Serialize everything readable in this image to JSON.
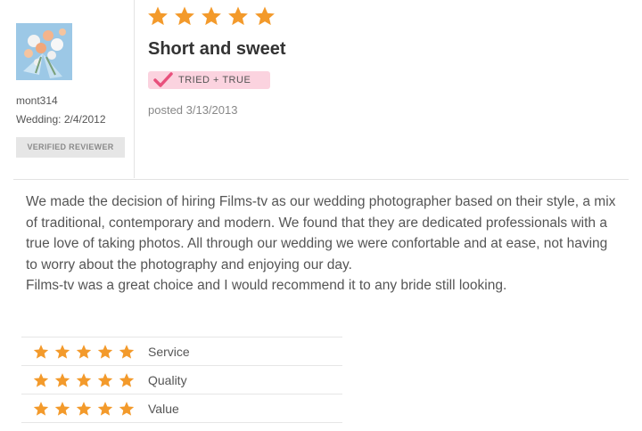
{
  "review": {
    "overall_rating": 5,
    "title": "Short and sweet",
    "badge": "TRIED + TRUE",
    "posted": "posted 3/13/2013",
    "paragraphs": [
      "We made the decision of hiring Films-tv as our wedding photographer based on their style, a mix of traditional, contemporary and modern. We found that they are dedicated professionals with a true love of taking photos. All through our wedding we were confortable and at ease, not having to worry about the photography and enjoying our day.",
      "Films-tv was a great choice and I would recommend it to any bride still looking."
    ]
  },
  "reviewer": {
    "username": "mont314",
    "wedding": "Wedding: 2/4/2012",
    "verified_label": "VERIFIED REVIEWER"
  },
  "ratings": [
    {
      "label": "Service",
      "stars": 5
    },
    {
      "label": "Quality",
      "stars": 5
    },
    {
      "label": "Value",
      "stars": 5
    }
  ],
  "colors": {
    "star": "#f39a2b",
    "badge_bg": "#fbd3df",
    "check": "#e8507c"
  },
  "icons": {
    "star": "star-icon",
    "check": "checkmark-icon",
    "avatar": "bouquet-avatar"
  }
}
